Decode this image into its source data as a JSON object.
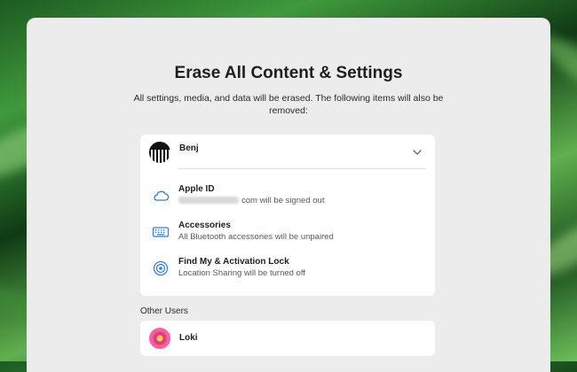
{
  "dialog": {
    "title": "Erase All Content & Settings",
    "subtitle": "All settings, media, and data will be erased. The following items will also be removed:"
  },
  "primary_user": {
    "name": "Benj",
    "items": [
      {
        "title": "Apple ID",
        "description": "com will be signed out",
        "icon": "cloud-icon"
      },
      {
        "title": "Accessories",
        "description": "All Bluetooth accessories will be unpaired",
        "icon": "keyboard-icon"
      },
      {
        "title": "Find My & Activation Lock",
        "description": "Location Sharing will be turned off",
        "icon": "findmy-icon"
      }
    ]
  },
  "other_users": {
    "label": "Other Users",
    "users": [
      {
        "name": "Loki"
      }
    ]
  },
  "colors": {
    "accent": "#2f7bd6",
    "window_bg": "#ececec",
    "card_bg": "#ffffff"
  }
}
